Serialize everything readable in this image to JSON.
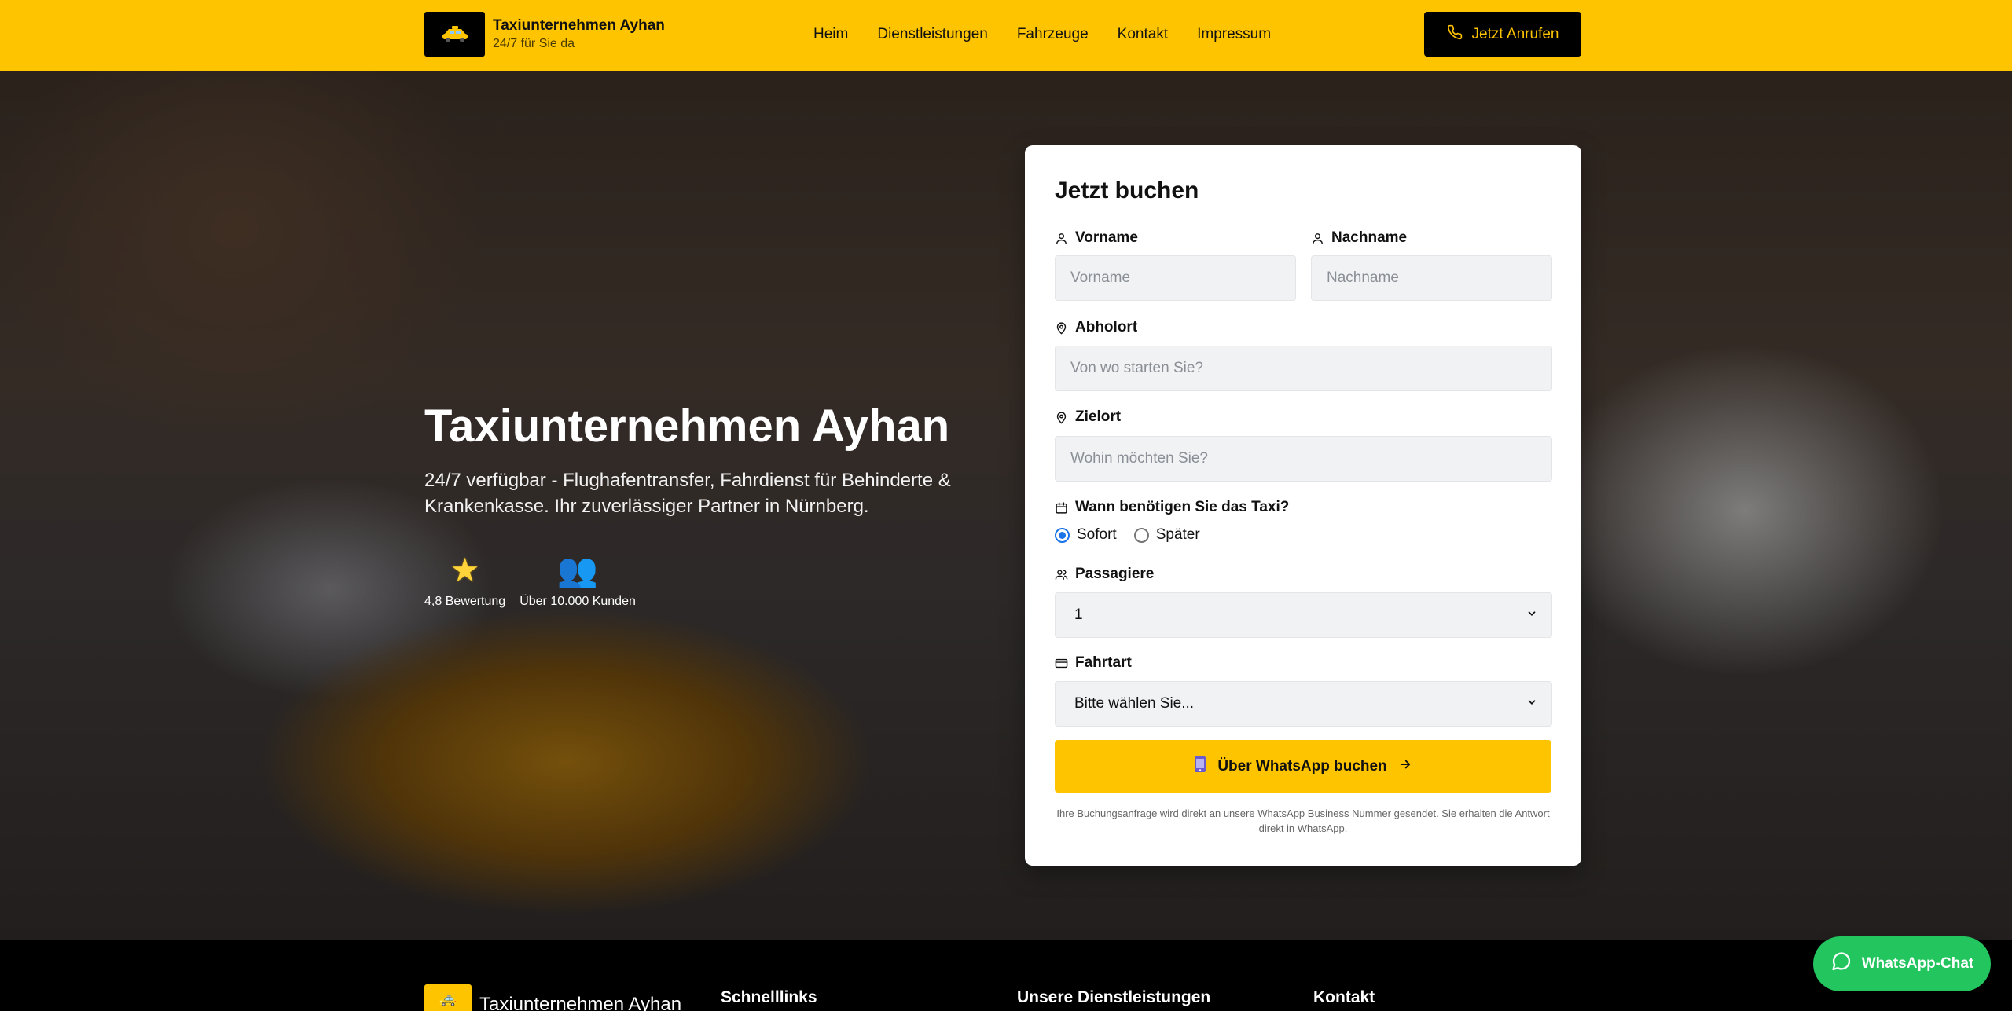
{
  "header": {
    "brand_name": "Taxiunternehmen Ayhan",
    "brand_tagline": "24/7 für Sie da",
    "logo_icon": "taxi-icon",
    "nav": [
      {
        "label": "Heim"
      },
      {
        "label": "Dienstleistungen"
      },
      {
        "label": "Fahrzeuge"
      },
      {
        "label": "Kontakt"
      },
      {
        "label": "Impressum"
      }
    ],
    "call_button": "Jetzt Anrufen",
    "call_icon": "phone-icon"
  },
  "hero": {
    "title": "Taxiunternehmen Ayhan",
    "subtitle": "24/7 verfügbar - Flughafentransfer, Fahrdienst für Behinderte & Krankenkasse. Ihr zuverlässiger Partner in Nürnberg.",
    "stats": [
      {
        "icon": "star-icon",
        "glyph": "★",
        "label": "4,8 Bewertung"
      },
      {
        "icon": "people-icon",
        "glyph": "👥",
        "label": "Über 10.000 Kunden"
      }
    ]
  },
  "booking": {
    "title": "Jetzt buchen",
    "first_name": {
      "label": "Vorname",
      "placeholder": "Vorname"
    },
    "last_name": {
      "label": "Nachname",
      "placeholder": "Nachname"
    },
    "pickup": {
      "label": "Abholort",
      "placeholder": "Von wo starten Sie?"
    },
    "destination": {
      "label": "Zielort",
      "placeholder": "Wohin möchten Sie?"
    },
    "when": {
      "label": "Wann benötigen Sie das Taxi?",
      "options": [
        {
          "label": "Sofort",
          "checked": true
        },
        {
          "label": "Später",
          "checked": false
        }
      ]
    },
    "passengers": {
      "label": "Passagiere",
      "value": "1"
    },
    "ride_type": {
      "label": "Fahrtart",
      "value": "Bitte wählen Sie..."
    },
    "submit": "Über WhatsApp buchen",
    "note": "Ihre Buchungsanfrage wird direkt an unsere WhatsApp Business Nummer gesendet. Sie erhalten die Antwort direkt in WhatsApp."
  },
  "footer": {
    "brand_name": "Taxiunternehmen Ayhan",
    "columns": [
      "Schnelllinks",
      "Unsere Dienstleistungen",
      "Kontakt"
    ]
  },
  "whatsapp_chat": {
    "label": "WhatsApp-Chat",
    "icon": "chat-bubble-icon"
  },
  "colors": {
    "accent": "#ffc400",
    "dark": "#000000",
    "whatsapp": "#22c55e",
    "radio": "#1a73e8"
  }
}
